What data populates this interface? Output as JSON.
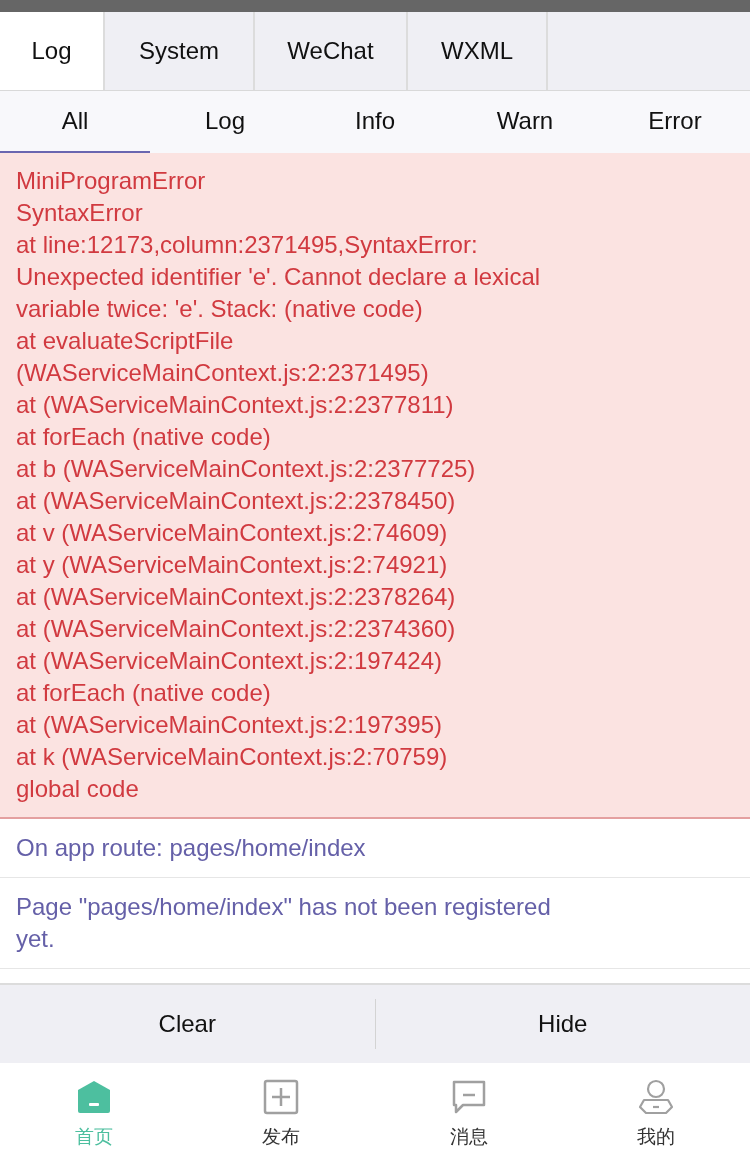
{
  "top_tabs": [
    {
      "label": "Log",
      "selected": true
    },
    {
      "label": "System",
      "selected": false
    },
    {
      "label": "WeChat",
      "selected": false
    },
    {
      "label": "WXML",
      "selected": false
    }
  ],
  "filter_tabs": [
    {
      "label": "All",
      "selected": true
    },
    {
      "label": "Log",
      "selected": false
    },
    {
      "label": "Info",
      "selected": false
    },
    {
      "label": "Warn",
      "selected": false
    },
    {
      "label": "Error",
      "selected": false
    }
  ],
  "logs": [
    {
      "kind": "error",
      "lines": [
        "MiniProgramError",
        "SyntaxError",
        "at line:12173,column:2371495,SyntaxError:",
        "Unexpected identifier 'e'. Cannot declare a lexical",
        "variable twice: 'e'. Stack: (native code)",
        "at evaluateScriptFile",
        "(WAServiceMainContext.js:2:2371495)",
        "at (WAServiceMainContext.js:2:2377811)",
        "at forEach (native code)",
        "at b (WAServiceMainContext.js:2:2377725)",
        "at (WAServiceMainContext.js:2:2378450)",
        "at v (WAServiceMainContext.js:2:74609)",
        "at y (WAServiceMainContext.js:2:74921)",
        "at (WAServiceMainContext.js:2:2378264)",
        "at (WAServiceMainContext.js:2:2374360)",
        "at (WAServiceMainContext.js:2:197424)",
        "at forEach (native code)",
        "at (WAServiceMainContext.js:2:197395)",
        "at k (WAServiceMainContext.js:2:70759)",
        "global code"
      ]
    },
    {
      "kind": "log",
      "lines": [
        "On app route: pages/home/index"
      ]
    },
    {
      "kind": "log",
      "lines": [
        "Page \"pages/home/index\" has not been registered",
        "yet."
      ]
    }
  ],
  "actions": [
    "Clear",
    "Hide"
  ],
  "tab_bar": [
    {
      "label": "首页",
      "selected": true
    },
    {
      "label": "发布",
      "selected": false
    },
    {
      "label": "消息",
      "selected": false
    },
    {
      "label": "我的",
      "selected": false
    }
  ]
}
